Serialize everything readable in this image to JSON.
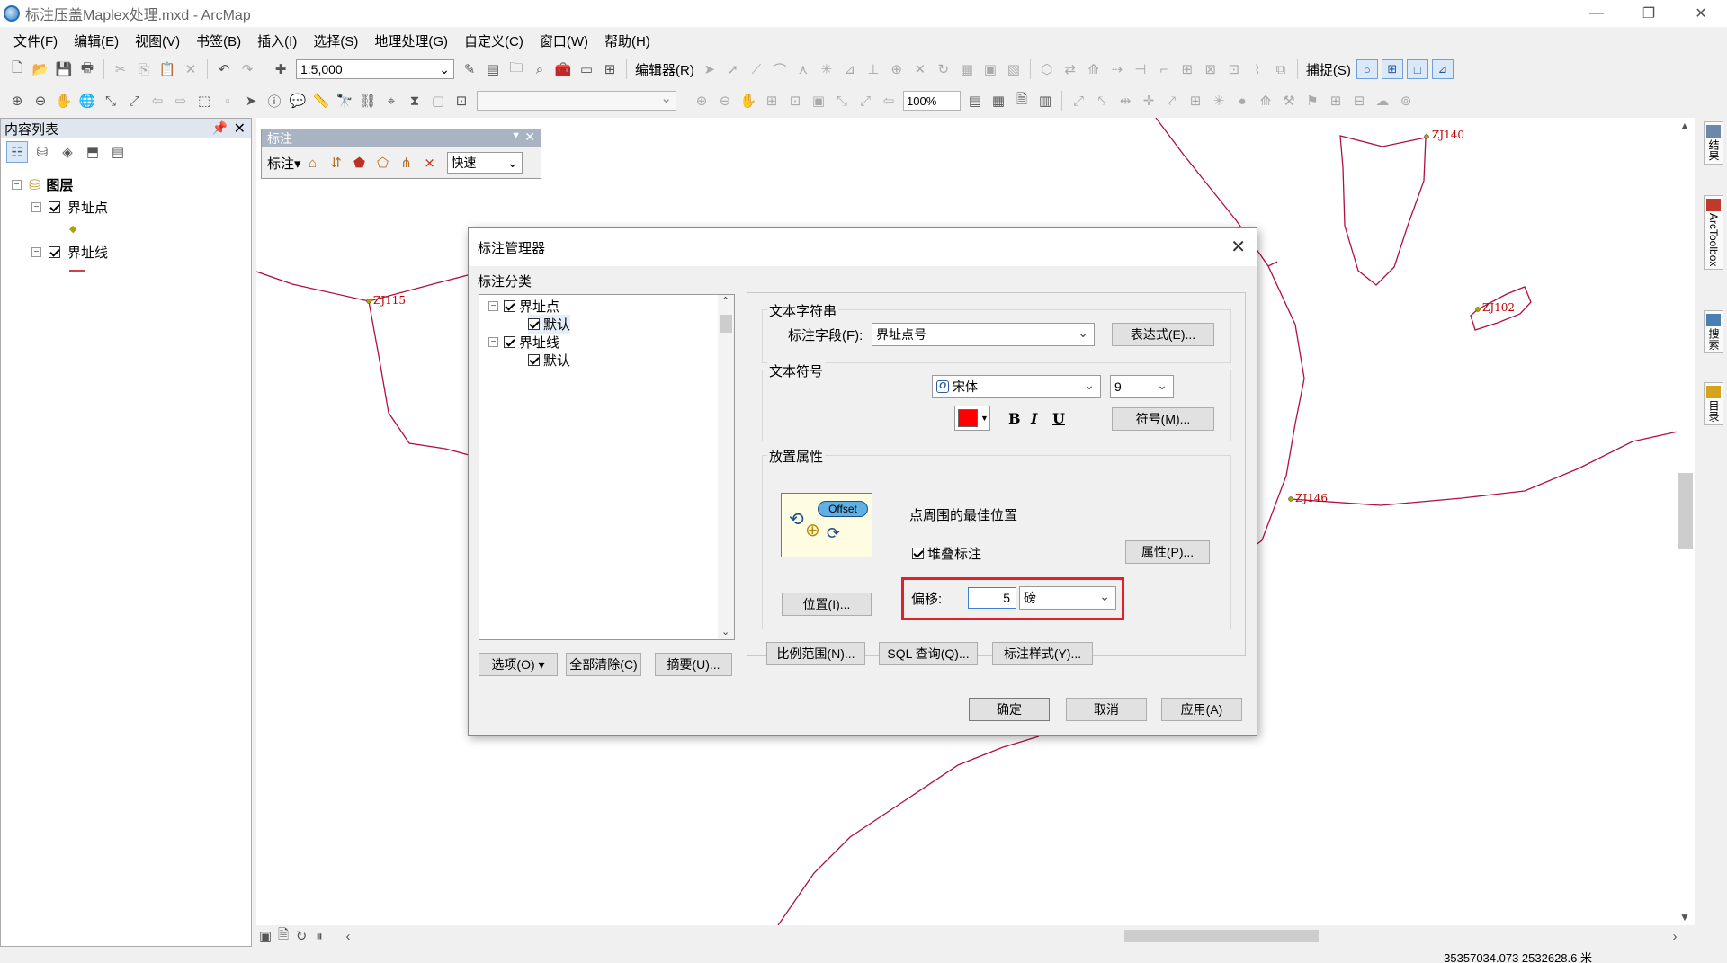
{
  "window": {
    "title": "标注压盖Maplex处理.mxd - ArcMap",
    "controls": [
      "—",
      "❐",
      "✕"
    ]
  },
  "menu": [
    "文件(F)",
    "编辑(E)",
    "视图(V)",
    "书签(B)",
    "插入(I)",
    "选择(S)",
    "地理处理(G)",
    "自定义(C)",
    "窗口(W)",
    "帮助(H)"
  ],
  "toolbar": {
    "scale": "1:5,000",
    "editor_label": "编辑器(R)",
    "snapping_label": "捕捉(S)",
    "zoom_percent": "100%"
  },
  "toc": {
    "title": "内容列表",
    "root": "图层",
    "layers": [
      {
        "name": "界址点",
        "checked": true,
        "symbol_color": "#b3a100"
      },
      {
        "name": "界址线",
        "checked": true,
        "symbol_color": "#d04050"
      }
    ]
  },
  "map": {
    "line_color": "#b01040",
    "labels": [
      {
        "text": "ZJ140"
      },
      {
        "text": "ZJ115"
      },
      {
        "text": "ZJ102"
      },
      {
        "text": "ZJ146"
      }
    ],
    "coordinates": "35357034.073  2532628.6 米"
  },
  "label_toolbar": {
    "title": "标注",
    "menu_label": "标注",
    "quick_value": "快速"
  },
  "right_dock": [
    "结果",
    "ArcToolbox",
    "搜索",
    "目录"
  ],
  "dialog": {
    "title": "标注管理器",
    "classes_heading": "标注分类",
    "classes": [
      {
        "name": "界址点",
        "checked": true,
        "children": [
          "默认"
        ]
      },
      {
        "name": "界址线",
        "checked": true,
        "children": [
          "默认"
        ]
      }
    ],
    "text_string": {
      "group": "文本字符串",
      "field_label": "标注字段(F):",
      "field_value": "界址点号",
      "expression_button": "表达式(E)..."
    },
    "text_symbol": {
      "group": "文本符号",
      "font": "宋体",
      "size": "9",
      "color": "#ff0000",
      "bold": "B",
      "italic": "I",
      "underline": "U",
      "symbol_button": "符号(M)..."
    },
    "placement": {
      "group": "放置属性",
      "icon_text": "Offset",
      "description": "点周围的最佳位置",
      "stack_label": "堆叠标注",
      "stack_checked": true,
      "properties_button": "属性(P)...",
      "position_button": "位置(I)...",
      "offset_label": "偏移:",
      "offset_value": "5",
      "offset_unit": "磅"
    },
    "scale_button": "比例范围(N)...",
    "sql_button": "SQL 查询(Q)...",
    "style_button": "标注样式(Y)...",
    "options_button": "选项(O)",
    "clear_all_button": "全部清除(C)",
    "summary_button": "摘要(U)...",
    "ok_button": "确定",
    "cancel_button": "取消",
    "apply_button": "应用(A)"
  }
}
